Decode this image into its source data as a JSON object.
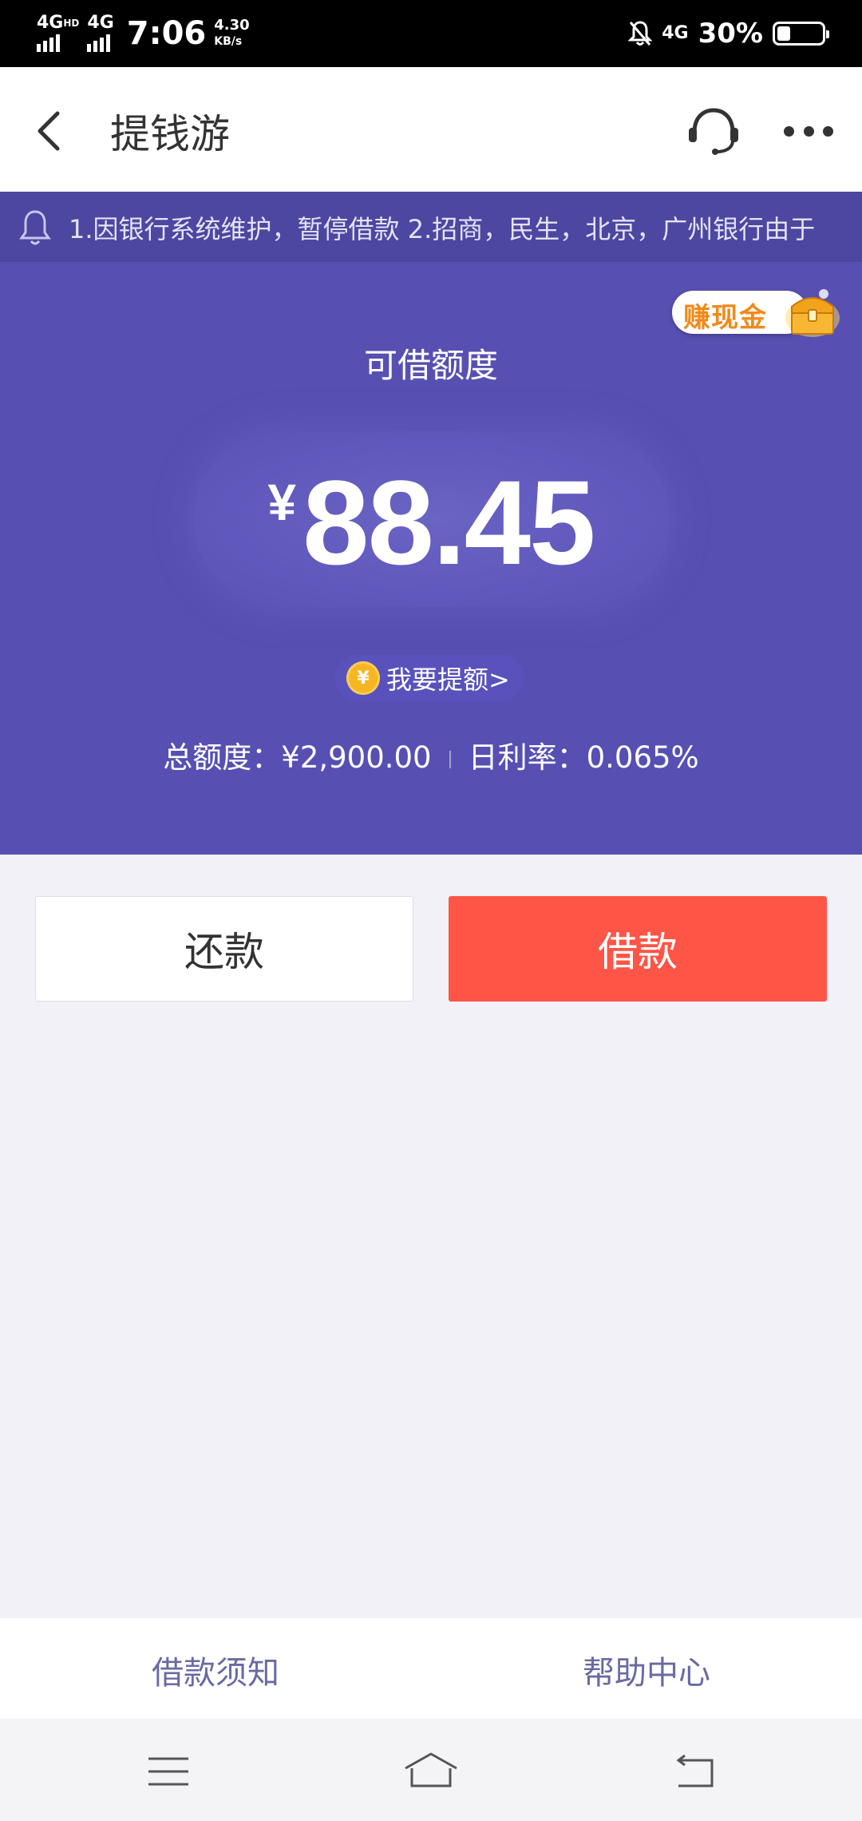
{
  "status_bar": {
    "net1": "4G",
    "net1_sup": "HD",
    "net2": "4G",
    "time": "7:06",
    "speed_value": "4.30",
    "speed_unit": "KB/s",
    "net3": "4G",
    "battery_pct": "30%",
    "battery_level": 0.3
  },
  "header": {
    "title": "提钱游",
    "icons": [
      "back-arrow-icon",
      "customer-service-icon",
      "more-icon"
    ]
  },
  "notice": {
    "text": "1.因银行系统维护，暂停借款 2.招商，民生，北京，广州银行由于"
  },
  "hero": {
    "earn_badge": "赚现金",
    "credit_label": "可借额度",
    "currency": "¥",
    "amount": "88.45",
    "coin_symbol": "¥",
    "raise_label": "我要提额>",
    "total_label": "总额度：¥2,900.00",
    "rate_label": "日利率：0.065%"
  },
  "actions": {
    "repay_label": "还款",
    "borrow_label": "借款"
  },
  "footer_links": {
    "notice_label": "借款须知",
    "help_label": "帮助中心"
  },
  "colors": {
    "hero_bg": "#5750b2",
    "notice_bg": "#4c47a0",
    "borrow_button": "#fe5546",
    "link_text": "#6a6aa3"
  }
}
